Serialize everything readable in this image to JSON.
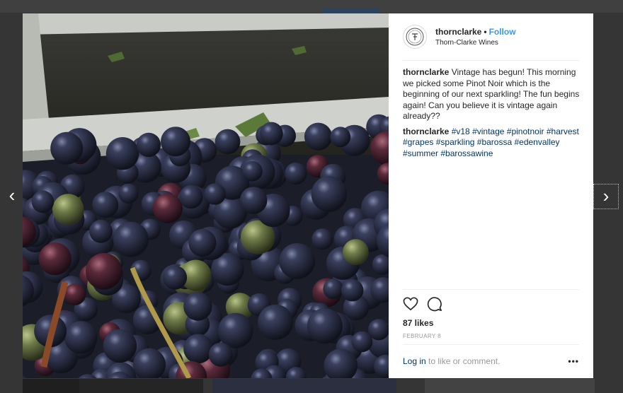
{
  "post": {
    "username": "thornclarke",
    "follow_label": "Follow",
    "separator": "•",
    "location": "Thorn-Clarke Wines",
    "caption": "Vintage has begun! This morning we picked some Pinot Noir which is the beginning of our next sparkling! The fun begins again! Can you believe it is vintage again already??",
    "hashtags": [
      "#v18",
      "#vintage",
      "#pinotnoir",
      "#harvest",
      "#grapes",
      "#sparkling",
      "#barossa",
      "#edenvalley",
      "#summer",
      "#barossawine"
    ],
    "likes": "87 likes",
    "date": "FEBRUARY 8",
    "login_link": "Log in",
    "login_suffix": " to like or comment.",
    "more": "•••"
  },
  "nav": {
    "prev": "‹",
    "next": "›"
  },
  "icons": {
    "like": "heart-icon",
    "comment": "comment-icon",
    "avatar": "thorn-clarke-logo"
  }
}
